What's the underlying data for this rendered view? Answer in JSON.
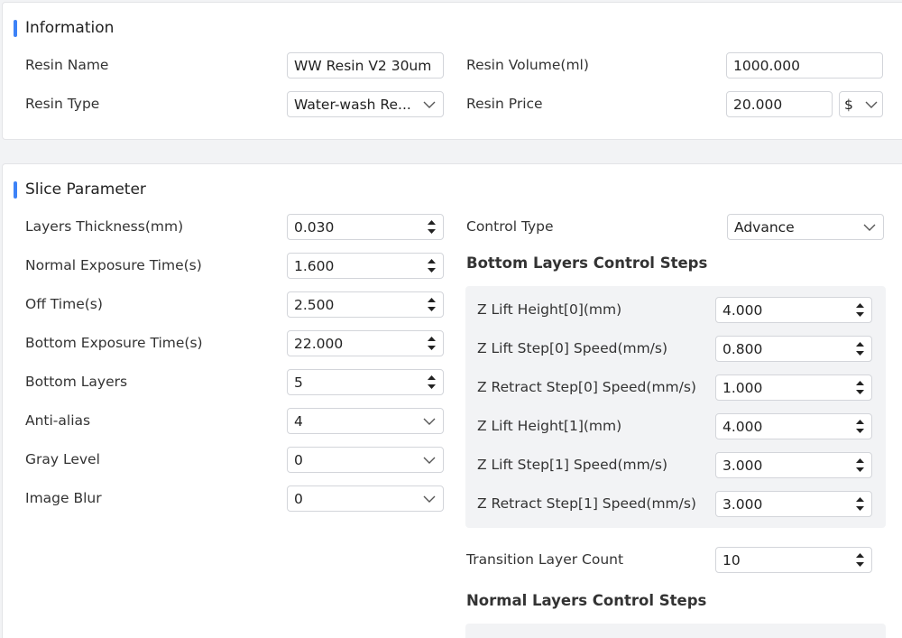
{
  "information": {
    "title": "Information",
    "resin_name": {
      "label": "Resin Name",
      "value": "WW Resin V2 30um"
    },
    "resin_type": {
      "label": "Resin Type",
      "value": "Water-wash Re..."
    },
    "resin_volume": {
      "label": "Resin Volume(ml)",
      "value": "1000.000"
    },
    "resin_price": {
      "label": "Resin Price",
      "value": "20.000",
      "currency": "$"
    }
  },
  "slice_parameter": {
    "title": "Slice Parameter",
    "left_fields": [
      {
        "label": "Layers Thickness(mm)",
        "value": "0.030",
        "kind": "spin"
      },
      {
        "label": "Normal Exposure Time(s)",
        "value": "1.600",
        "kind": "spin"
      },
      {
        "label": "Off Time(s)",
        "value": "2.500",
        "kind": "spin"
      },
      {
        "label": "Bottom Exposure Time(s)",
        "value": "22.000",
        "kind": "spin"
      },
      {
        "label": "Bottom Layers",
        "value": "5",
        "kind": "spin"
      },
      {
        "label": "Anti-alias",
        "value": "4",
        "kind": "select"
      },
      {
        "label": "Gray Level",
        "value": "0",
        "kind": "select"
      },
      {
        "label": "Image Blur",
        "value": "0",
        "kind": "select"
      }
    ],
    "control_type": {
      "label": "Control Type",
      "value": "Advance"
    },
    "bottom_steps_title": "Bottom Layers Control Steps",
    "bottom_steps": [
      {
        "label": "Z Lift Height[0](mm)",
        "value": "4.000"
      },
      {
        "label": "Z Lift Step[0] Speed(mm/s)",
        "value": "0.800"
      },
      {
        "label": "Z Retract Step[0] Speed(mm/s)",
        "value": "1.000"
      },
      {
        "label": "Z Lift Height[1](mm)",
        "value": "4.000"
      },
      {
        "label": "Z Lift Step[1] Speed(mm/s)",
        "value": "3.000"
      },
      {
        "label": "Z Retract Step[1] Speed(mm/s)",
        "value": "3.000"
      }
    ],
    "transition_layer_count": {
      "label": "Transition Layer Count",
      "value": "10"
    },
    "normal_steps_title": "Normal Layers Control Steps"
  },
  "colors": {
    "accent": "#3d82f7",
    "panel_bg": "#ffffff",
    "page_bg": "#f2f3f5",
    "group_bg": "#f2f3f5"
  }
}
